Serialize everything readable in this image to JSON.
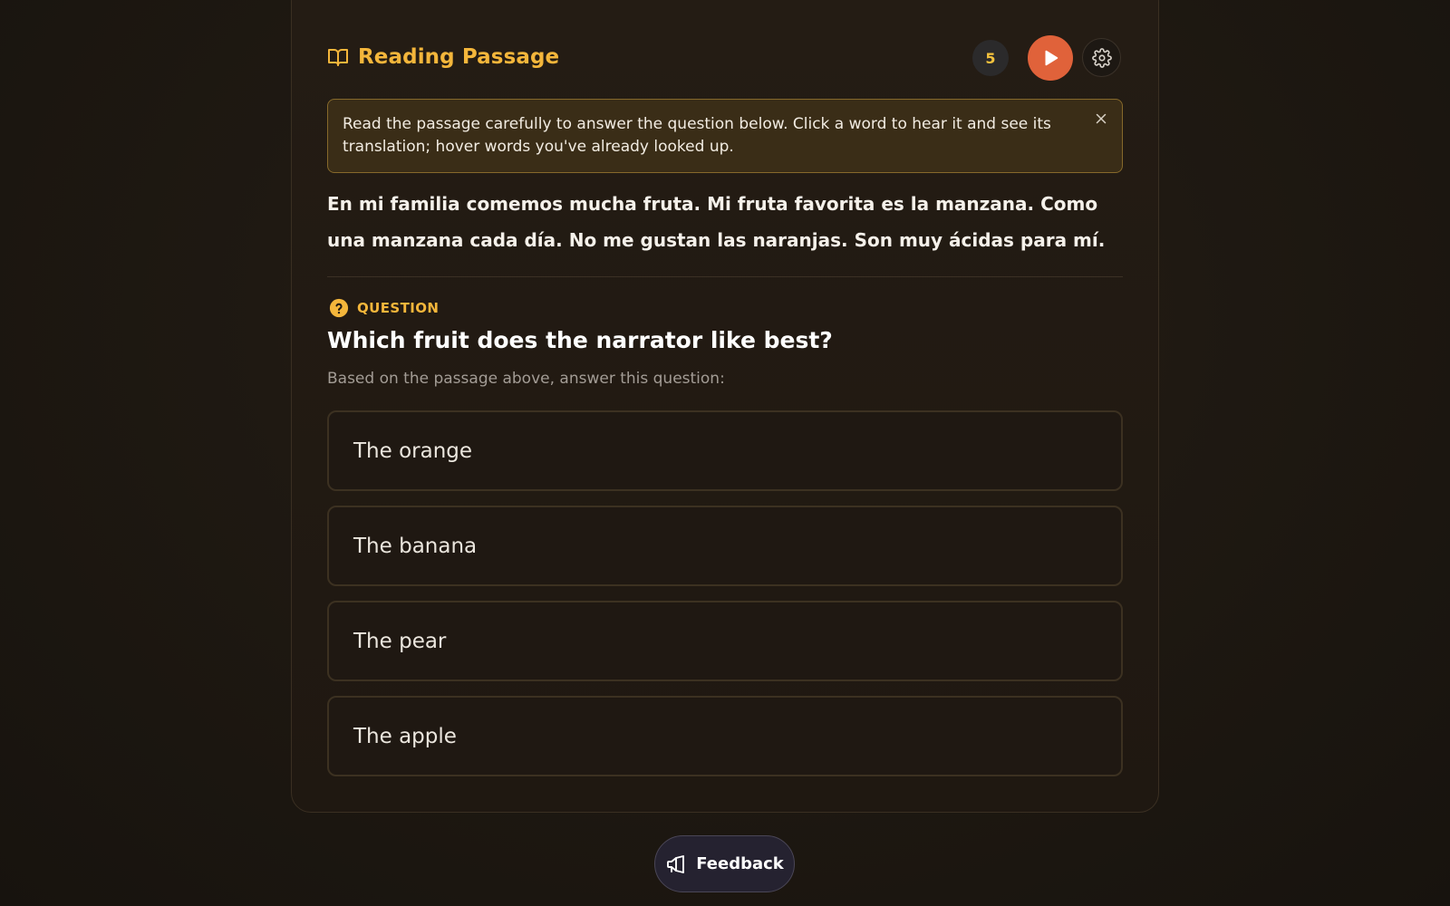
{
  "header": {
    "title": "Reading Passage",
    "count": "5",
    "icons": {
      "title": "book-open-icon",
      "play": "play-icon",
      "settings": "gear-icon"
    }
  },
  "notice": {
    "text": "Read the passage carefully to answer the question below. Click a word to hear it and see its translation; hover words you've already looked up.",
    "close_icon": "close-icon"
  },
  "passage": {
    "text": "En mi familia comemos mucha fruta. Mi fruta favorita es la manzana. Como una manzana cada día. No me gustan las naranjas. Son muy ácidas para mí."
  },
  "question": {
    "label": "QUESTION",
    "icon": "question-circle-icon",
    "text": "Which fruit does the narrator like best?",
    "subtext": "Based on the passage above, answer this question:",
    "options": [
      {
        "label": "The orange"
      },
      {
        "label": "The banana"
      },
      {
        "label": "The pear"
      },
      {
        "label": "The apple"
      }
    ]
  },
  "feedback": {
    "label": "Feedback",
    "icon": "megaphone-icon"
  },
  "colors": {
    "accent": "#f4b63b",
    "play": "#e0623a",
    "background": "#1f1912"
  }
}
